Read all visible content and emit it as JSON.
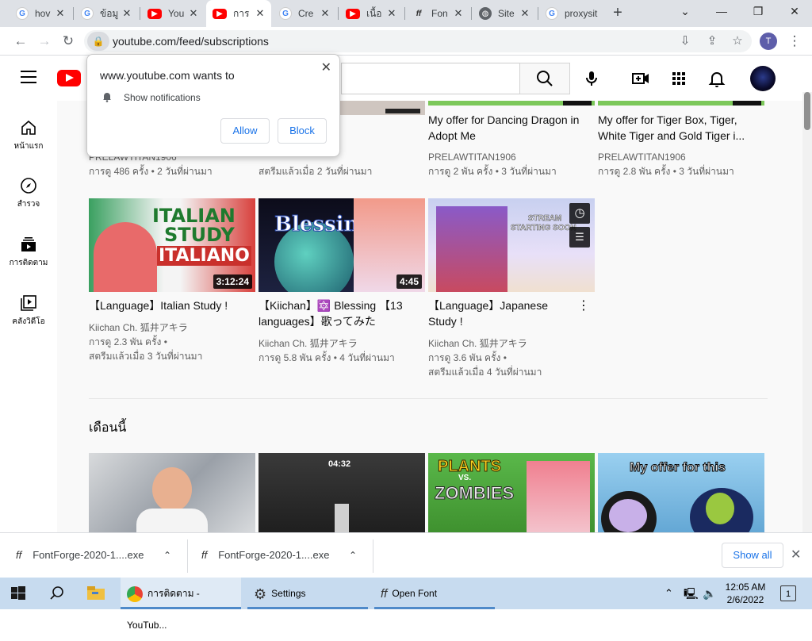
{
  "browser": {
    "tabs": [
      {
        "icon": "google-icon",
        "title": "hov",
        "active": false
      },
      {
        "icon": "google-icon",
        "title": "ข้อมู",
        "active": false
      },
      {
        "icon": "youtube-icon",
        "title": "You",
        "active": false
      },
      {
        "icon": "youtube-icon",
        "title": "การ",
        "active": true
      },
      {
        "icon": "google-icon",
        "title": "Cre",
        "active": false
      },
      {
        "icon": "youtube-icon",
        "title": "เนื้อ",
        "active": false
      },
      {
        "icon": "fontforge-icon",
        "title": "Fon",
        "active": false
      },
      {
        "icon": "globe-icon",
        "title": "Site",
        "active": false
      },
      {
        "icon": "google-icon",
        "title": "proxysit",
        "active": false
      }
    ],
    "url": "youtube.com/feed/subscriptions",
    "profile_initial": "T"
  },
  "notification_prompt": {
    "site": "www.youtube.com wants to",
    "message": "Show notifications",
    "allow": "Allow",
    "block": "Block"
  },
  "guide": {
    "home": "หน้าแรก",
    "explore": "สำรวจ",
    "subscriptions": "การติดตาม",
    "library": "คลังวิดีโอ"
  },
  "videos_row1": [
    {
      "title": "",
      "channel": "PRELAWTITAN1906",
      "meta": "การดู 486 ครั้ง • 2 วันที่ผ่านมา"
    },
    {
      "title": "orean Study !",
      "channel": "",
      "meta": "สตรีมแล้วเมื่อ 2 วันที่ผ่านมา"
    },
    {
      "title": "My offer for Dancing Dragon in Adopt Me",
      "channel": "PRELAWTITAN1906",
      "meta": "การดู 2 พัน ครั้ง • 3 วันที่ผ่านมา"
    },
    {
      "title": "My offer for Tiger Box, Tiger, White Tiger and Gold Tiger i...",
      "channel": "PRELAWTITAN1906",
      "meta": "การดู 2.8 พัน ครั้ง • 3 วันที่ผ่านมา"
    }
  ],
  "videos_row2": [
    {
      "title": "【Language】Italian Study !",
      "channel": "Kiichan Ch. 狐井アキラ",
      "meta1": "การดู 2.3 พัน ครั้ง •",
      "meta2": "สตรีมแล้วเมื่อ 3 วันที่ผ่านมา",
      "duration": "3:12:24",
      "thumb_text1": "ITALIAN",
      "thumb_text2": "STUDY",
      "thumb_text3": "ITALIANO"
    },
    {
      "title": "【Kiichan】🔯 Blessing 【13 languages】歌ってみた",
      "channel": "Kiichan Ch. 狐井アキラ",
      "meta1": "การดู 5.8 พัน ครั้ง • 4 วันที่ผ่านมา",
      "meta2": "",
      "duration": "4:45",
      "thumb_text1": "Blessing"
    },
    {
      "title": "【Language】Japanese Study !",
      "channel": "Kiichan Ch. 狐井アキラ",
      "meta1": "การดู 3.6 พัน ครั้ง •",
      "meta2": "สตรีมแล้วเมื่อ 4 วันที่ผ่านมา",
      "duration": "",
      "thumb_text1": "STREAM",
      "thumb_text2": "STARTING SOON"
    }
  ],
  "section_title": "เดือนนี้",
  "row3_thumbs": {
    "dur2": "04:32",
    "plants": "PLANTS",
    "vs": "VS.",
    "zombies": "ZOMBIES",
    "offer": "My offer for this"
  },
  "downloads": [
    {
      "name": "FontForge-2020-1....exe"
    },
    {
      "name": "FontForge-2020-1....exe"
    }
  ],
  "download_bar": {
    "show_all": "Show all"
  },
  "taskbar": {
    "chrome": "การติดตาม - YouTub...",
    "settings": "Settings",
    "openfont": "Open Font",
    "time": "12:05 AM",
    "date": "2/6/2022",
    "notifications": "1"
  }
}
